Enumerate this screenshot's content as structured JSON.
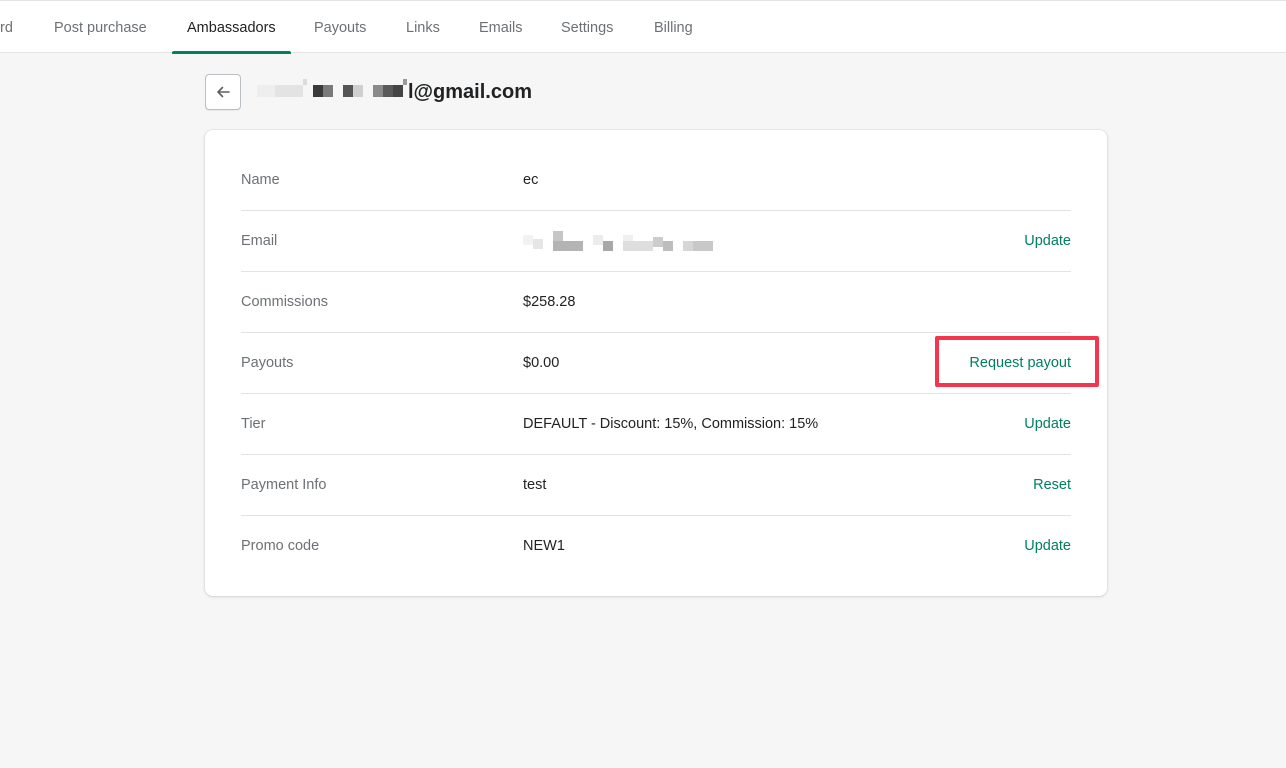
{
  "tabs": [
    {
      "label": "rd"
    },
    {
      "label": "Post purchase"
    },
    {
      "label": "Ambassadors"
    },
    {
      "label": "Payouts"
    },
    {
      "label": "Links"
    },
    {
      "label": "Emails"
    },
    {
      "label": "Settings"
    },
    {
      "label": "Billing"
    }
  ],
  "active_tab": "Ambassadors",
  "header": {
    "title_suffix": "l@gmail.com",
    "back_icon": "arrow-left-icon"
  },
  "details": {
    "rows": [
      {
        "label": "Name",
        "value": "ec",
        "action": ""
      },
      {
        "label": "Email",
        "value": "",
        "action": "Update"
      },
      {
        "label": "Commissions",
        "value": "$258.28",
        "action": ""
      },
      {
        "label": "Payouts",
        "value": "$0.00",
        "action": "Request payout"
      },
      {
        "label": "Tier",
        "value": "DEFAULT - Discount: 15%, Commission: 15%",
        "action": "Update"
      },
      {
        "label": "Payment Info",
        "value": "test",
        "action": "Reset"
      },
      {
        "label": "Promo code",
        "value": "NEW1",
        "action": "Update"
      }
    ]
  },
  "colors": {
    "accent": "#008060",
    "highlight": "#f4364c",
    "background": "#f6f6f7"
  }
}
